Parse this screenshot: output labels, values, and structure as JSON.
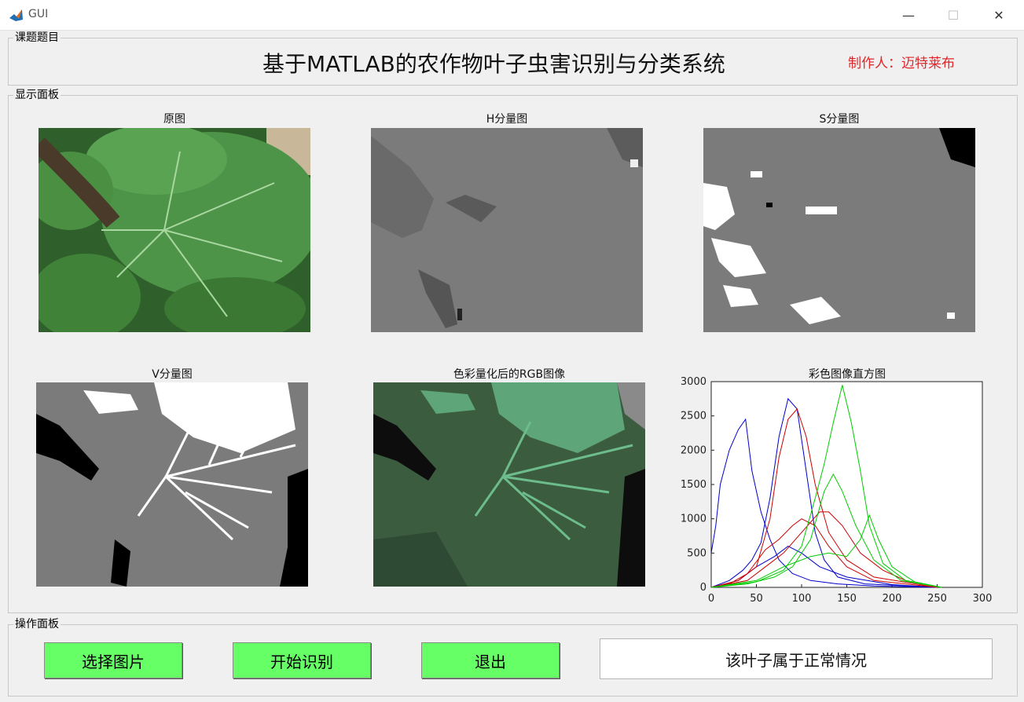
{
  "window": {
    "title": "GUI"
  },
  "topic_panel": {
    "label": "课题题目",
    "title": "基于MATLAB的农作物叶子虫害识别与分类系统",
    "author": "制作人：迈特莱布"
  },
  "display_panel": {
    "label": "显示面板",
    "images": [
      {
        "title": "原图"
      },
      {
        "title": "H分量图"
      },
      {
        "title": "S分量图"
      },
      {
        "title": "V分量图"
      },
      {
        "title": "色彩量化后的RGB图像"
      },
      {
        "title": "彩色图像直方图"
      }
    ]
  },
  "control_panel": {
    "label": "操作面板",
    "select_label": "选择图片",
    "start_label": "开始识别",
    "exit_label": "退出",
    "result": "该叶子属于正常情况"
  },
  "chart_data": {
    "type": "line",
    "title": "彩色图像直方图",
    "xlim": [
      0,
      300
    ],
    "ylim": [
      0,
      3000
    ],
    "x_ticks": [
      0,
      50,
      100,
      150,
      200,
      250,
      300
    ],
    "y_ticks": [
      0,
      500,
      1000,
      1500,
      2000,
      2500,
      3000
    ],
    "grid": false,
    "series": [
      {
        "color": "#0000cc",
        "points": [
          [
            0,
            500
          ],
          [
            5,
            900
          ],
          [
            10,
            1500
          ],
          [
            20,
            2000
          ],
          [
            30,
            2300
          ],
          [
            38,
            2450
          ],
          [
            45,
            1700
          ],
          [
            55,
            1100
          ],
          [
            65,
            700
          ],
          [
            75,
            400
          ],
          [
            90,
            200
          ],
          [
            110,
            100
          ],
          [
            140,
            50
          ],
          [
            180,
            20
          ],
          [
            250,
            0
          ]
        ]
      },
      {
        "color": "#0000cc",
        "points": [
          [
            0,
            0
          ],
          [
            20,
            100
          ],
          [
            35,
            250
          ],
          [
            45,
            400
          ],
          [
            55,
            650
          ],
          [
            65,
            1300
          ],
          [
            75,
            2200
          ],
          [
            85,
            2750
          ],
          [
            95,
            2600
          ],
          [
            105,
            1700
          ],
          [
            115,
            800
          ],
          [
            125,
            400
          ],
          [
            140,
            150
          ],
          [
            170,
            50
          ],
          [
            250,
            0
          ]
        ]
      },
      {
        "color": "#0000cc",
        "points": [
          [
            0,
            0
          ],
          [
            30,
            100
          ],
          [
            50,
            300
          ],
          [
            70,
            450
          ],
          [
            85,
            600
          ],
          [
            100,
            500
          ],
          [
            120,
            300
          ],
          [
            150,
            150
          ],
          [
            200,
            40
          ],
          [
            250,
            0
          ]
        ]
      },
      {
        "color": "#cc0000",
        "points": [
          [
            0,
            0
          ],
          [
            20,
            50
          ],
          [
            40,
            200
          ],
          [
            60,
            550
          ],
          [
            75,
            700
          ],
          [
            90,
            900
          ],
          [
            100,
            1000
          ],
          [
            115,
            900
          ],
          [
            130,
            600
          ],
          [
            150,
            300
          ],
          [
            180,
            100
          ],
          [
            250,
            0
          ]
        ]
      },
      {
        "color": "#cc0000",
        "points": [
          [
            0,
            0
          ],
          [
            30,
            100
          ],
          [
            50,
            300
          ],
          [
            65,
            1000
          ],
          [
            75,
            1900
          ],
          [
            85,
            2450
          ],
          [
            95,
            2600
          ],
          [
            105,
            2200
          ],
          [
            115,
            1500
          ],
          [
            130,
            800
          ],
          [
            150,
            400
          ],
          [
            180,
            150
          ],
          [
            250,
            0
          ]
        ]
      },
      {
        "color": "#cc0000",
        "points": [
          [
            0,
            0
          ],
          [
            40,
            100
          ],
          [
            60,
            300
          ],
          [
            80,
            500
          ],
          [
            100,
            800
          ],
          [
            120,
            1100
          ],
          [
            130,
            1100
          ],
          [
            145,
            900
          ],
          [
            165,
            500
          ],
          [
            190,
            250
          ],
          [
            215,
            100
          ],
          [
            255,
            0
          ]
        ]
      },
      {
        "color": "#00cc00",
        "points": [
          [
            0,
            0
          ],
          [
            40,
            50
          ],
          [
            70,
            150
          ],
          [
            90,
            300
          ],
          [
            110,
            700
          ],
          [
            125,
            1400
          ],
          [
            135,
            1650
          ],
          [
            145,
            1400
          ],
          [
            160,
            900
          ],
          [
            180,
            400
          ],
          [
            210,
            100
          ],
          [
            255,
            0
          ]
        ]
      },
      {
        "color": "#00cc00",
        "points": [
          [
            0,
            0
          ],
          [
            50,
            80
          ],
          [
            80,
            250
          ],
          [
            100,
            600
          ],
          [
            115,
            1300
          ],
          [
            125,
            1800
          ],
          [
            135,
            2400
          ],
          [
            145,
            2950
          ],
          [
            155,
            2400
          ],
          [
            165,
            1700
          ],
          [
            175,
            900
          ],
          [
            190,
            350
          ],
          [
            215,
            100
          ],
          [
            255,
            0
          ]
        ]
      },
      {
        "color": "#00cc00",
        "points": [
          [
            0,
            0
          ],
          [
            50,
            100
          ],
          [
            80,
            300
          ],
          [
            110,
            450
          ],
          [
            130,
            500
          ],
          [
            150,
            450
          ],
          [
            165,
            700
          ],
          [
            175,
            1050
          ],
          [
            185,
            700
          ],
          [
            200,
            300
          ],
          [
            225,
            80
          ],
          [
            255,
            0
          ]
        ]
      }
    ]
  }
}
